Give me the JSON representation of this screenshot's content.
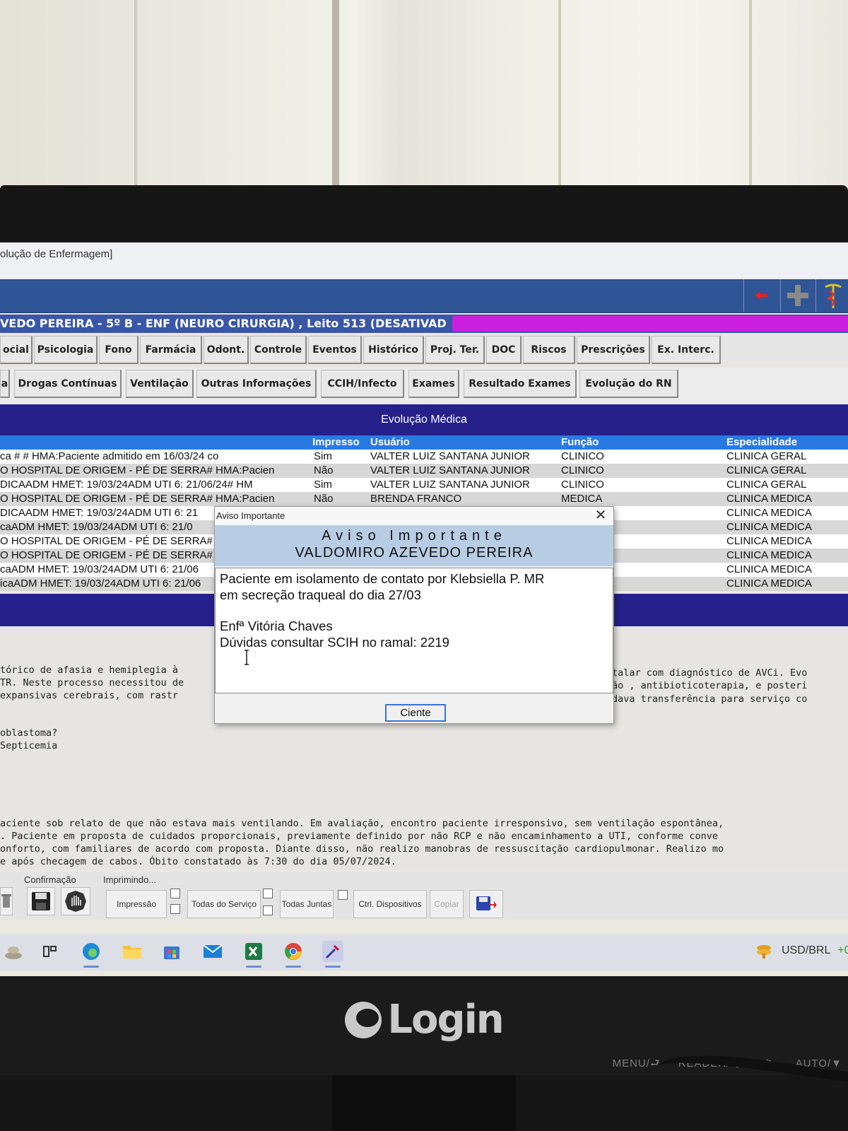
{
  "window": {
    "title": "olução de Enfermagem]"
  },
  "patient_bar": {
    "text": "VEDO PEREIRA  - 5º  B - ENF (NEURO CIRURGIA) , Leito 513 (DESATIVAD"
  },
  "tabs_row1": [
    "ocial",
    "Psicologia",
    "Fono",
    "Farmácia",
    "Odont.",
    "Controle",
    "Eventos",
    "Histórico",
    "Proj. Ter.",
    "DOC",
    "Riscos",
    "Prescrições",
    "Ex. Interc."
  ],
  "tabs_row2": [
    "a",
    "Drogas Contínuas",
    "Ventilação",
    "Outras Informações",
    "CCIH/Infecto",
    "Exames",
    "Resultado Exames",
    "Evolução do RN"
  ],
  "section_title": "Evolução Médica",
  "table": {
    "headers": [
      "Impresso",
      "Usuário",
      "Função",
      "Especialidade"
    ],
    "rows": [
      {
        "text": "ca # # HMA:Paciente admitido em 16/03/24 co",
        "impresso": "Sim",
        "usuario": "VALTER LUIZ SANTANA JUNIOR",
        "funcao": "CLINICO",
        "especialidade": "CLINICA GERAL"
      },
      {
        "text": "O HOSPITAL DE ORIGEM - PÉ DE SERRA# HMA:Pacien",
        "impresso": "Não",
        "usuario": "VALTER LUIZ SANTANA JUNIOR",
        "funcao": "CLINICO",
        "especialidade": "CLINICA GERAL"
      },
      {
        "text": "DICAADM HMET: 19/03/24ADM UTI 6: 21/06/24# HM",
        "impresso": "Sim",
        "usuario": "VALTER LUIZ SANTANA JUNIOR",
        "funcao": "CLINICO",
        "especialidade": "CLINICA GERAL"
      },
      {
        "text": "O HOSPITAL DE ORIGEM - PÉ DE SERRA# HMA:Pacien",
        "impresso": "Não",
        "usuario": "BRENDA FRANCO",
        "funcao": "MEDICA",
        "especialidade": "CLINICA MEDICA"
      },
      {
        "text": "DICAADM HMET: 19/03/24ADM UTI 6: 21",
        "impresso": "",
        "usuario": "",
        "funcao": "",
        "especialidade": "CLINICA MEDICA"
      },
      {
        "text": "caADM HMET: 19/03/24ADM UTI 6: 21/0",
        "impresso": "",
        "usuario": "",
        "funcao": "",
        "especialidade": "CLINICA MEDICA"
      },
      {
        "text": "O HOSPITAL DE ORIGEM - PÉ DE SERRA#",
        "impresso": "",
        "usuario": "",
        "funcao": "",
        "especialidade": "CLINICA MEDICA"
      },
      {
        "text": "O HOSPITAL DE ORIGEM - PÉ DE SERRA#",
        "impresso": "",
        "usuario": "",
        "funcao": "",
        "especialidade": "CLINICA MEDICA"
      },
      {
        "text": "caADM HMET: 19/03/24ADM UTI 6: 21/06",
        "impresso": "",
        "usuario": "",
        "funcao": "",
        "especialidade": "CLINICA MEDICA"
      },
      {
        "text": "icaADM HMET: 19/03/24ADM UTI 6: 21/06",
        "impresso": "",
        "usuario": "",
        "funcao": "",
        "especialidade": "CLINICA MEDICA"
      }
    ]
  },
  "text_area": {
    "left_lines": [
      "tórico de afasia e hemiplegia à",
      "TR. Neste processo necessitou de",
      " expansivas cerebrais, com rastr"
    ],
    "right_lines": [
      "talar com diagnóstico de AVCi. Evo",
      "ão , antibioticoterapia, e posteri",
      "dava transferência para serviço co"
    ],
    "diagnoses": [
      "oblastoma?",
      "Septicemia"
    ],
    "bottom_lines": [
      "aciente sob relato de que não estava mais ventilando. Em avaliação, encontro paciente irresponsivo, sem ventilação espontânea,",
      ". Paciente em proposta de cuidados proporcionais, previamente definido por não RCP e não encaminhamento a  UTI, conforme conve",
      "onforto, com familiares de acordo com proposta. Diante disso, não realizo manobras de ressuscitação cardiopulmonar. Realizo mo",
      "e após checagem de cabos. Óbito constatado às 7:30 do dia 05/07/2024."
    ]
  },
  "bottom_toolbar": {
    "confirmacao_label": "Confirmação",
    "imprimindo_label": "Imprimindo...",
    "impressao": "Impressão",
    "todas_servico": "Todas do Serviço",
    "todas_juntas": "Todas Juntas",
    "ctrl_dispositivos": "Ctrl. Dispositivos",
    "copiar": "Copiar"
  },
  "taskbar": {
    "ticker": "USD/BRL",
    "ticker_change": "+0"
  },
  "dialog": {
    "title": "Aviso Importante",
    "heading": "Aviso Importante",
    "patient_name": "VALDOMIRO AZEVEDO PEREIRA",
    "message_lines": [
      "Paciente em isolamento de contato por Klebsiella P. MR",
      "em secreção traqueal do dia 27/03",
      "",
      "Enfª Vitória Chaves",
      "Dúvidas consultar SCIH no ramal: 2219"
    ],
    "ok_label": "Ciente"
  },
  "monitor": {
    "brand": "Login",
    "osd": [
      "MENU/⮐",
      "READER/◀",
      "∞/▶",
      "AUTO/▼"
    ]
  },
  "colors": {
    "toolbar": "#2f5596",
    "section": "#25208a",
    "header": "#2979e3",
    "alert_bar": "#cc1ee0",
    "dialog_header": "#b8cde4"
  }
}
